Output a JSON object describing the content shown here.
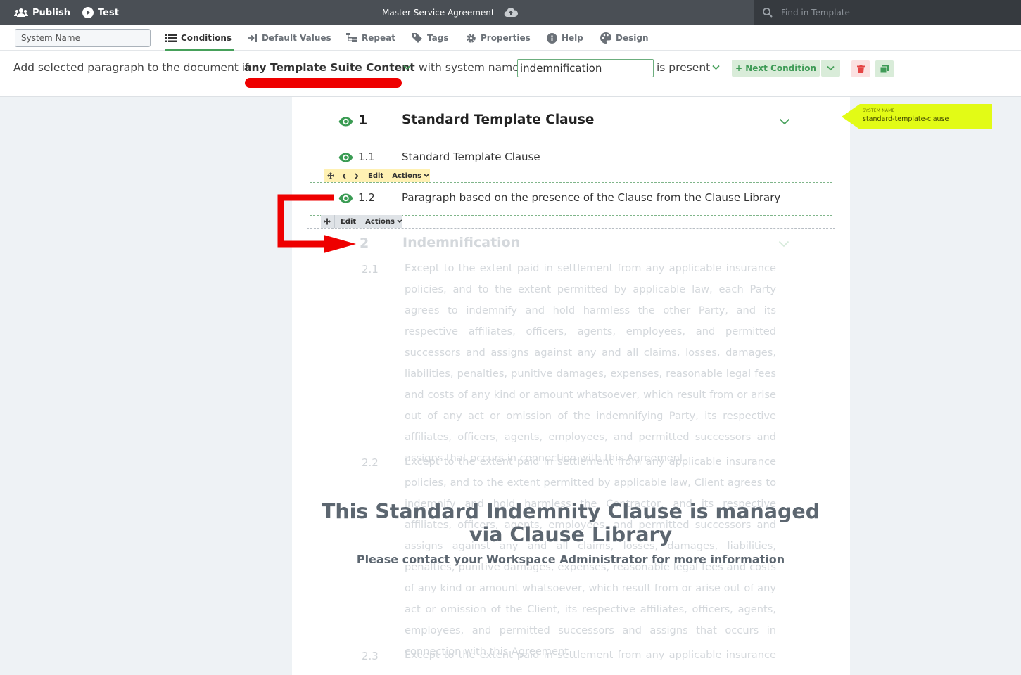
{
  "topbar": {
    "publish_label": "Publish",
    "test_label": "Test",
    "doc_title": "Master Service Agreement",
    "search_placeholder": "Find in Template"
  },
  "tabs": {
    "system_name_placeholder": "System Name",
    "items": [
      {
        "label": "Conditions",
        "active": true
      },
      {
        "label": "Default Values"
      },
      {
        "label": "Repeat"
      },
      {
        "label": "Tags"
      },
      {
        "label": "Properties"
      },
      {
        "label": "Help"
      },
      {
        "label": "Design"
      }
    ]
  },
  "condition": {
    "prefix": "Add selected paragraph to the document if:",
    "selector": "any Template Suite Content",
    "with_label": "with system name",
    "system_name_value": "indemnification",
    "operator": "is present",
    "next_condition_label": "+ Next Condition"
  },
  "document": {
    "section1": {
      "number": "1",
      "title": "Standard Template Clause",
      "system_name_label": "SYSTEM NAME",
      "system_name_value": "standard-template-clause",
      "sub": [
        {
          "number": "1.1",
          "text": "Standard Template Clause"
        },
        {
          "number": "1.2",
          "text": "Paragraph based on the presence of the Clause from the Clause Library"
        }
      ]
    },
    "toolbar": {
      "edit_label": "Edit",
      "actions_label": "Actions"
    },
    "section2": {
      "number": "2",
      "title": "Indemnification",
      "sub": [
        {
          "number": "2.1",
          "text": "Except to the extent paid in settlement from any applicable insurance policies, and to the extent permitted by applicable law, each Party agrees to indemnify and hold harmless the other Party, and its respective affiliates, officers, agents, employees, and permitted successors and assigns against any and all claims, losses, damages, liabilities, penalties, punitive damages, expenses, reasonable legal fees and costs of any kind or amount whatsoever, which result from or arise out of any act or omission of the indemnifying Party, its respective affiliates, officers, agents, employees, and permitted successors and assigns that occurs in connection with this Agreement"
        },
        {
          "number": "2.2",
          "text": "Except to the extent paid in settlement from any applicable insurance policies, and to the extent permitted by applicable law, Client agrees to indemnify and hold harmless the Contractor, and its respective affiliates, officers, agents, employees, and permitted successors and assigns against any and all claims, losses, damages, liabilities, penalties, punitive damages, expenses, reasonable legal fees and costs of any kind or amount whatsoever, which result from or arise out of any act or omission of the Client, its respective affiliates, officers, agents, employees, and permitted successors and assigns that occurs in connection with this Agreement"
        },
        {
          "number": "2.3",
          "text": "Except to the extent paid in settlement from any applicable insurance"
        }
      ]
    },
    "overlay": {
      "title": "This Standard Indemnity Clause is managed via Clause Library",
      "subtitle": "Please contact your Workspace Administrator for more information"
    }
  },
  "colors": {
    "topbar_bg": "#4a4f55",
    "accent_green": "#46a05a",
    "annotation_red": "#ee0000",
    "system_tag_yellow": "#e2fb16"
  }
}
